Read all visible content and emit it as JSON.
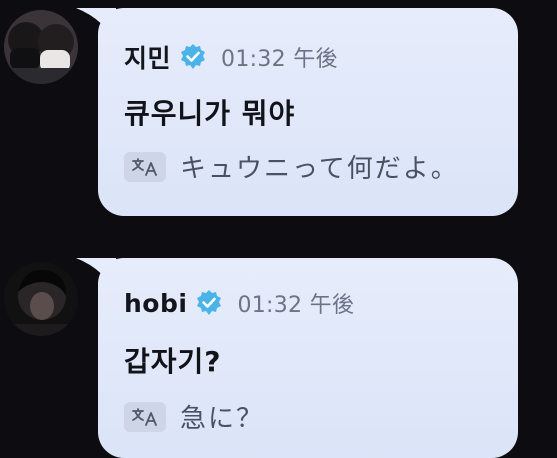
{
  "messages": [
    {
      "name": "지민",
      "time": "01:32 午後",
      "text": "큐우니가 뭐야",
      "translation": "キュウニって何だよ。",
      "avatar_icon": "user-avatar-photo"
    },
    {
      "name": "hobi",
      "time": "01:32 午後",
      "text": "갑자기?",
      "translation": "急に？",
      "avatar_icon": "user-avatar-photo"
    }
  ],
  "translate_icon": "translate-icon",
  "verified_icon": "verified-badge-icon",
  "colors": {
    "background": "#0d0c10",
    "bubble": "#e2e9fa",
    "verified": "#4ab4e8",
    "time": "#6b7385"
  }
}
